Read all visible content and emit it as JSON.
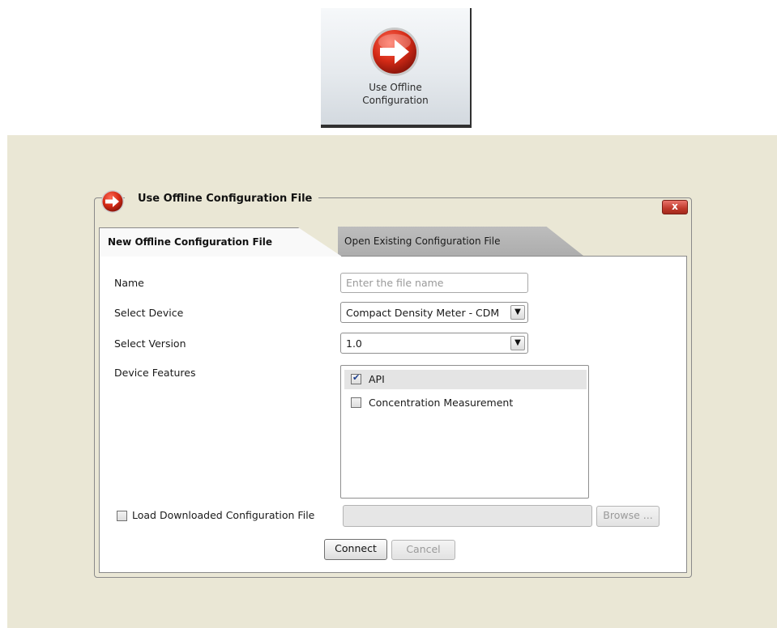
{
  "tile": {
    "label_line1": "Use Offline",
    "label_line2": "Configuration",
    "icon": "arrow-right-icon"
  },
  "dialog": {
    "title": "Use Offline Configuration File",
    "title_icon": "arrow-right-icon",
    "close_label": "x",
    "tabs": [
      {
        "label": "New Offline Configuration File",
        "active": true
      },
      {
        "label": "Open Existing Configuration File",
        "active": false
      }
    ],
    "form": {
      "name_label": "Name",
      "name_value": "",
      "name_placeholder": "Enter the file name",
      "device_label": "Select Device",
      "device_value": "Compact Density Meter - CDM",
      "version_label": "Select Version",
      "version_value": "1.0",
      "features_label": "Device Features",
      "features": [
        {
          "label": "API",
          "checked": true,
          "selected": true
        },
        {
          "label": "Concentration Measurement",
          "checked": false,
          "selected": false
        }
      ],
      "load_label": "Load Downloaded Configuration File",
      "load_checked": false,
      "load_path": "",
      "browse_label": "Browse ..."
    },
    "buttons": {
      "connect": "Connect",
      "cancel": "Cancel"
    }
  },
  "colors": {
    "panel_bg": "#eae7d5",
    "icon_red": "#c62a1a",
    "check_blue": "#1d3f8f"
  }
}
